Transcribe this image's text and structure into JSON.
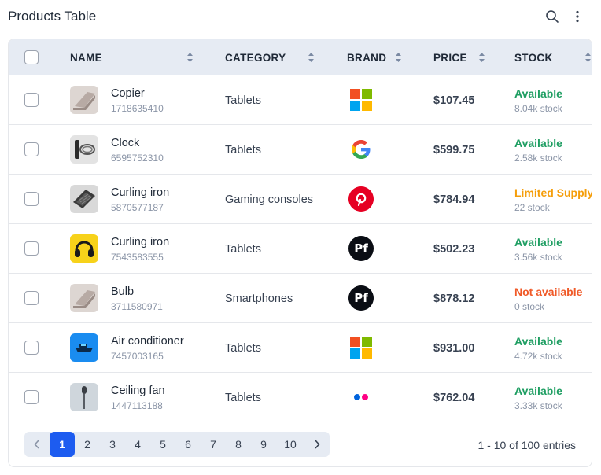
{
  "header": {
    "title": "Products Table",
    "search_icon": "search-icon",
    "more_icon": "more-vertical-icon"
  },
  "table": {
    "columns": [
      "NAME",
      "CATEGORY",
      "BRAND",
      "PRICE",
      "STOCK"
    ],
    "rows": [
      {
        "name": "Copier",
        "sku": "1718635410",
        "category": "Tablets",
        "brand": "microsoft-logo",
        "price": "$107.45",
        "status": "Available",
        "stock": "8.04k stock",
        "status_color": "#1e9e62",
        "thumb": "laptop"
      },
      {
        "name": "Clock",
        "sku": "6595752310",
        "category": "Tablets",
        "brand": "google-logo",
        "price": "$599.75",
        "status": "Available",
        "stock": "2.58k stock",
        "status_color": "#1e9e62",
        "thumb": "cable"
      },
      {
        "name": "Curling iron",
        "sku": "5870577187",
        "category": "Gaming consoles",
        "brand": "pinterest-logo",
        "price": "$784.94",
        "status": "Limited Supply",
        "stock": "22 stock",
        "status_color": "#f59e0b",
        "thumb": "keyboard"
      },
      {
        "name": "Curling iron",
        "sku": "7543583555",
        "category": "Tablets",
        "brand": "pf-logo",
        "price": "$502.23",
        "status": "Available",
        "stock": "3.56k stock",
        "status_color": "#1e9e62",
        "thumb": "headphones"
      },
      {
        "name": "Bulb",
        "sku": "3711580971",
        "category": "Smartphones",
        "brand": "pf-logo",
        "price": "$878.12",
        "status": "Not available",
        "stock": "0 stock",
        "status_color": "#f05a28",
        "thumb": "laptop"
      },
      {
        "name": "Air conditioner",
        "sku": "7457003165",
        "category": "Tablets",
        "brand": "microsoft-logo",
        "price": "$931.00",
        "status": "Available",
        "stock": "4.72k stock",
        "status_color": "#1e9e62",
        "thumb": "boat"
      },
      {
        "name": "Ceiling fan",
        "sku": "1447113188",
        "category": "Tablets",
        "brand": "flickr-logo",
        "price": "$762.04",
        "status": "Available",
        "stock": "3.33k stock",
        "status_color": "#1e9e62",
        "thumb": "mic"
      }
    ]
  },
  "pagination": {
    "prev_icon": "chevron-left-icon",
    "next_icon": "chevron-right-icon",
    "pages": [
      "1",
      "2",
      "3",
      "4",
      "5",
      "6",
      "7",
      "8",
      "9",
      "10"
    ],
    "current": "1",
    "summary": "1 - 10 of 100 entries"
  }
}
